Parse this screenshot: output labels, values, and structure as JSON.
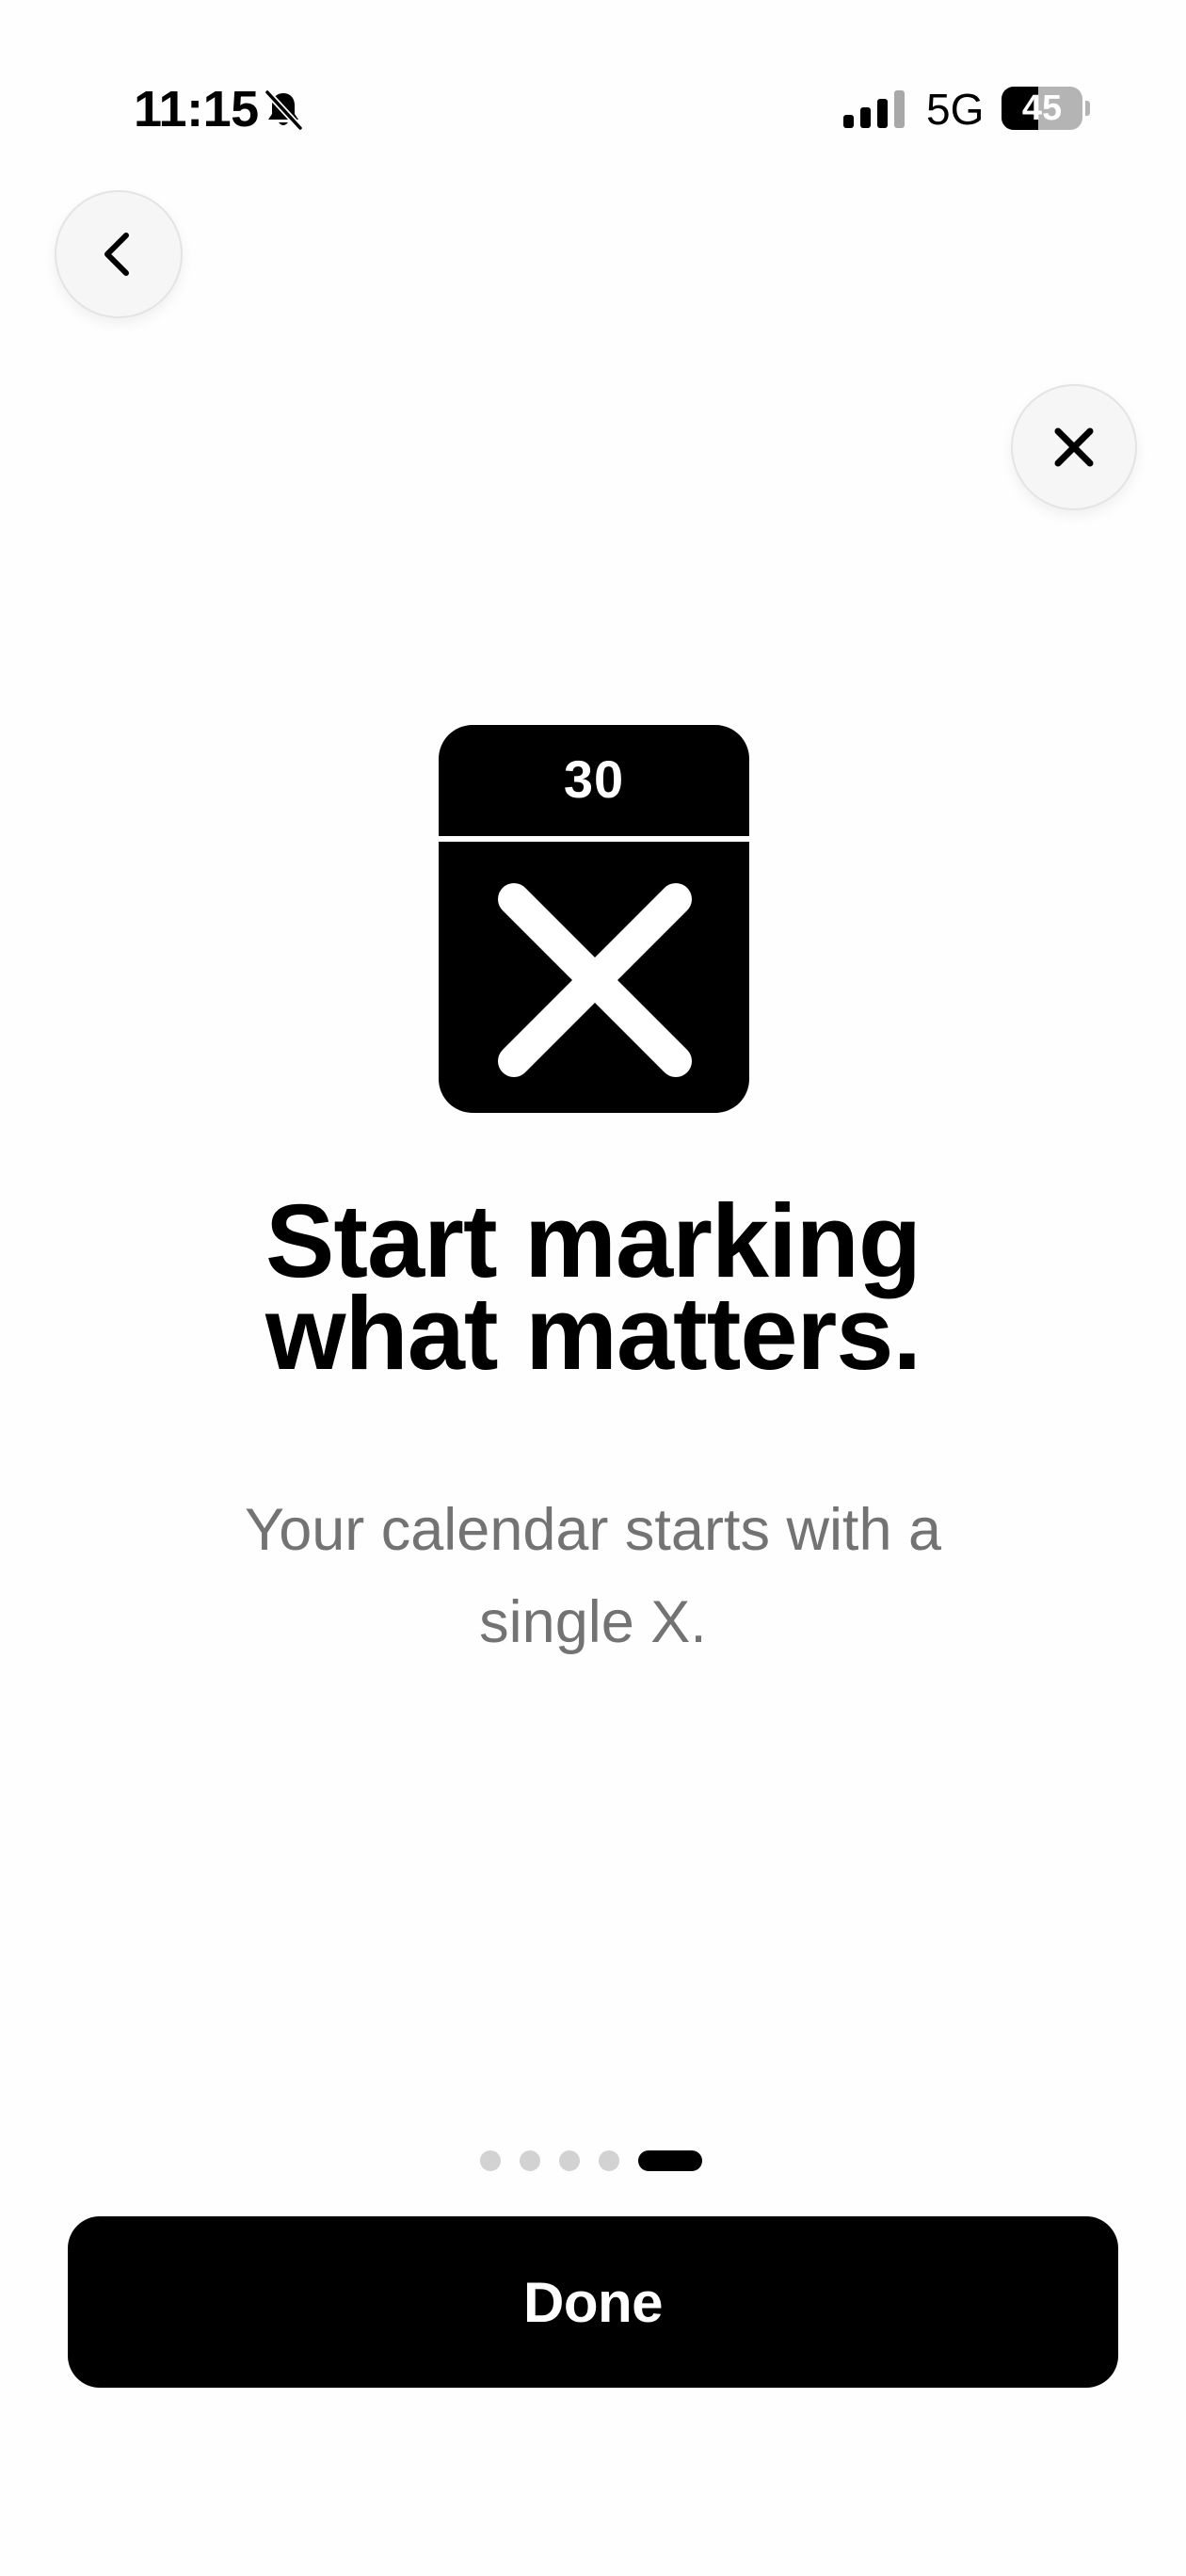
{
  "status_bar": {
    "time": "11:15",
    "network": "5G",
    "battery_percent": "45",
    "battery_level": 0.45,
    "icons": [
      "bell-slash-icon",
      "cellular-signal-icon",
      "battery-icon"
    ]
  },
  "navigation": {
    "back_icon": "chevron-left-icon",
    "close_icon": "close-icon"
  },
  "illustration": {
    "calendar_day": "30",
    "mark_icon": "x-mark-icon"
  },
  "content": {
    "headline_line1": "Start marking",
    "headline_line2": "what matters.",
    "subtitle_line1": "Your calendar starts with a",
    "subtitle_line2": "single X."
  },
  "pagination": {
    "total_pages": 5,
    "current_page": 5
  },
  "actions": {
    "done_label": "Done"
  },
  "colors": {
    "background": "#fefefe",
    "primary": "#000000",
    "subtitle": "#737373",
    "inactive_dot": "#d2d2d2"
  }
}
